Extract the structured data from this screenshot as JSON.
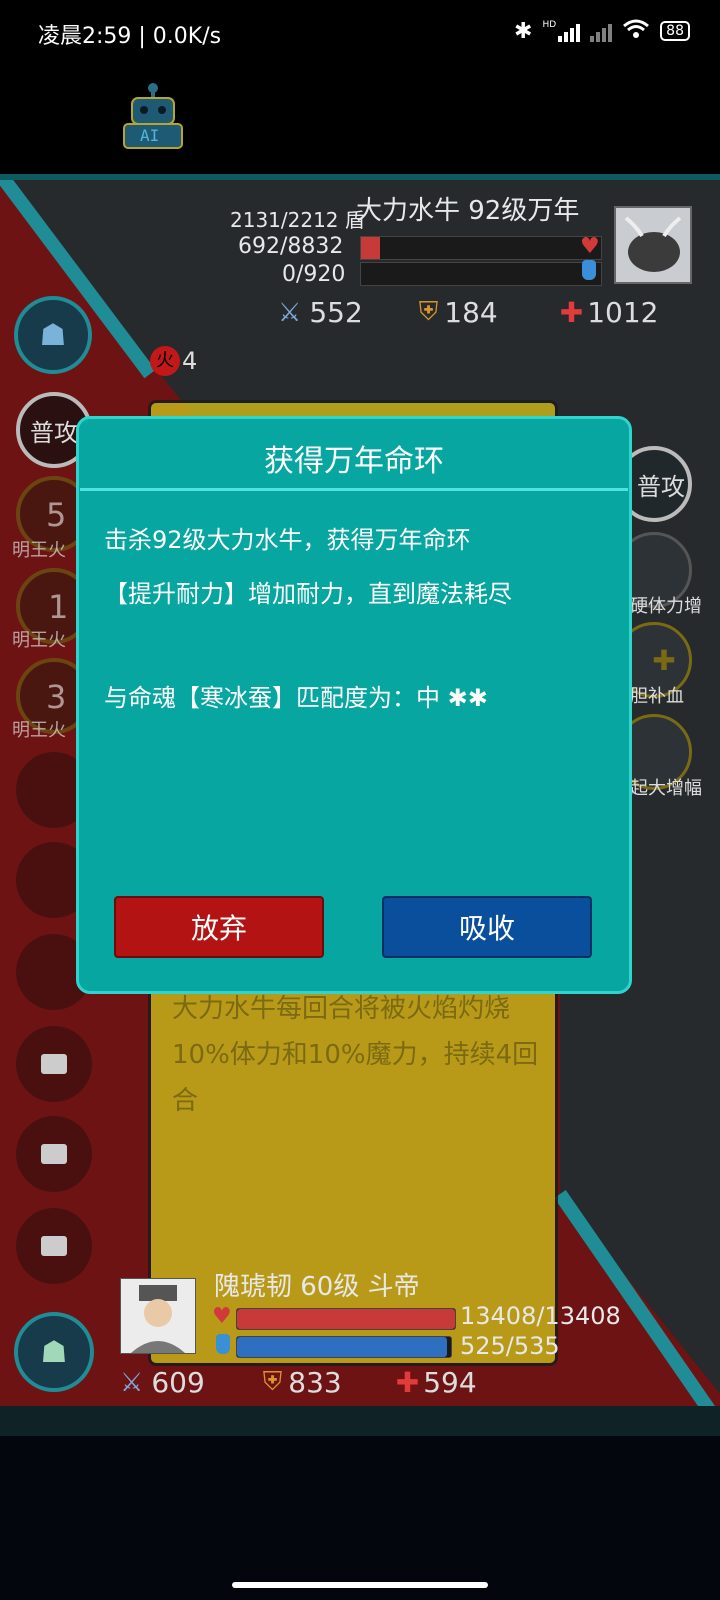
{
  "status_bar": {
    "time_speed": "凌晨2:59 | 0.0K/s",
    "hd_label": "HD",
    "battery": "88"
  },
  "top": {
    "ai_label": "AI"
  },
  "enemy": {
    "name_line": "大力水牛 92级万年",
    "shield": "2131/2212 盾",
    "hp": "692/8832",
    "hp_fraction": 0.078,
    "mp": "0/920",
    "mp_fraction": 0.0,
    "attack": "552",
    "defense": "184",
    "heal": "1012",
    "burn_count": "4"
  },
  "left_skills": {
    "normal_attack": "普攻",
    "skill1_count": "5",
    "skill1_label": "明王火",
    "skill2_count": "1",
    "skill2_label": "明王火",
    "skill3_count": "3",
    "skill3_label": "明王火"
  },
  "right_skills": {
    "normal_attack": "普攻",
    "skill1_label": "硬体力增",
    "skill2_label": "胆补血",
    "skill3_label": "起大增幅"
  },
  "battle_log": {
    "text": "大力水牛每回合将被火焰灼烧10%体力和10%魔力，持续4回合"
  },
  "modal": {
    "title": "获得万年命环",
    "line1": "击杀92级大力水牛，获得万年命环",
    "line2": "【提升耐力】增加耐力，直到魔法耗尽",
    "line3": "与命魂【寒冰蚕】匹配度为：中 ✱✱",
    "abandon_label": "放弃",
    "absorb_label": "吸收"
  },
  "player": {
    "name_line": "隗琥韧 60级 斗帝",
    "hp": "13408/13408",
    "hp_fraction": 1.0,
    "mp": "525/535",
    "mp_fraction": 0.98,
    "attack": "609",
    "defense": "833",
    "heal": "594"
  },
  "colors": {
    "modal_bg": "#07a6a0",
    "abandon": "#b31312",
    "absorb": "#0a4f9c",
    "hp_bar": "#c83a3a",
    "mp_bar": "#2f6fbf"
  }
}
